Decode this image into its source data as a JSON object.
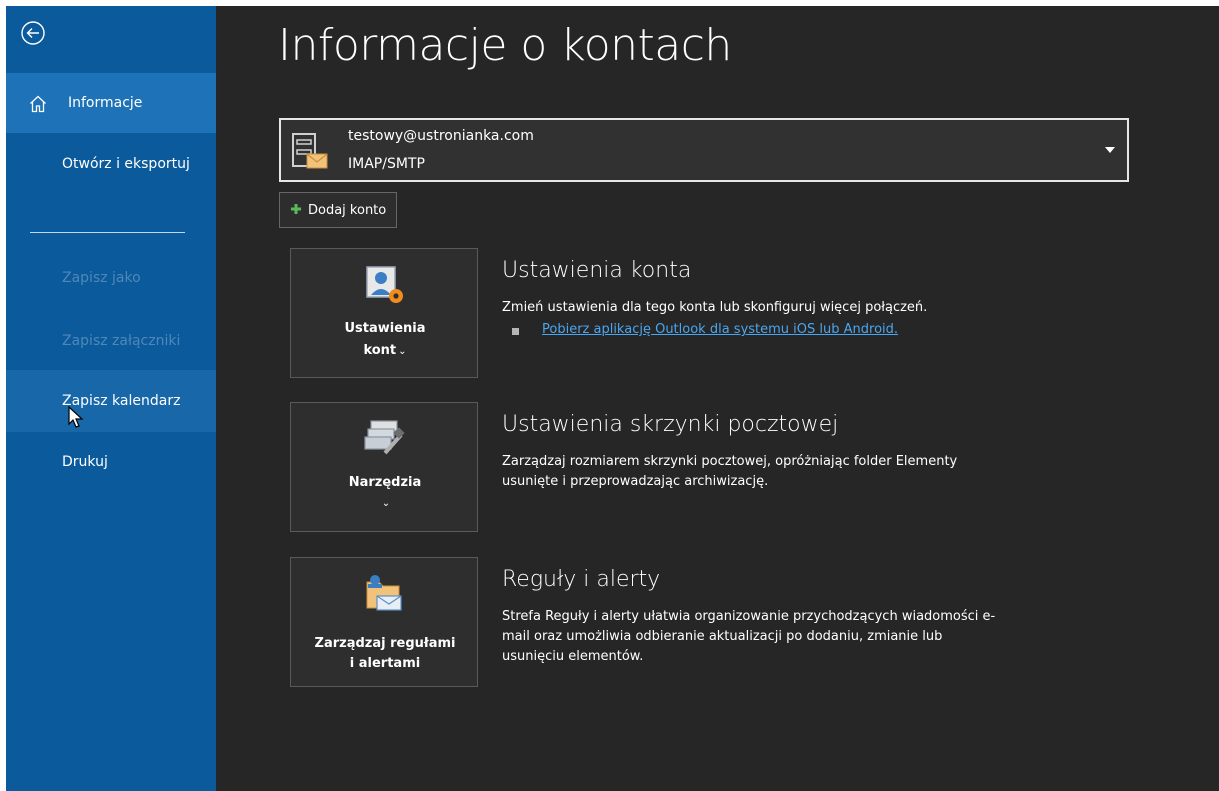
{
  "sidebar": {
    "back_icon": "back-arrow-icon",
    "items": [
      {
        "label": "Informacje",
        "icon": "home-icon",
        "state": "selected"
      },
      {
        "label": "Otwórz i eksportuj",
        "state": "normal"
      },
      {
        "label": "Zapisz jako",
        "state": "disabled"
      },
      {
        "label": "Zapisz załączniki",
        "state": "disabled"
      },
      {
        "label": "Zapisz kalendarz",
        "state": "hover"
      },
      {
        "label": "Drukuj",
        "state": "normal"
      }
    ]
  },
  "page": {
    "title": "Informacje o kontach"
  },
  "account": {
    "email": "testowy@ustronianka.com",
    "type": "IMAP/SMTP",
    "icon": "account-mailbox-icon"
  },
  "add_account": {
    "label": "Dodaj konto",
    "icon": "plus-icon"
  },
  "sections": {
    "account_settings": {
      "tile_label_line1": "Ustawienia",
      "tile_label_line2": "kont",
      "icon": "account-settings-icon",
      "title": "Ustawienia konta",
      "description": "Zmień ustawienia dla tego konta lub skonfiguruj więcej połączeń.",
      "link": "Pobierz aplikację Outlook dla systemu iOS lub Android."
    },
    "mailbox_settings": {
      "tile_label": "Narzędzia",
      "icon": "tools-icon",
      "title": "Ustawienia skrzynki pocztowej",
      "description_line1": "Zarządzaj rozmiarem skrzynki pocztowej, opróżniając folder Elementy",
      "description_line2": "usunięte i przeprowadzając archiwizację."
    },
    "rules_alerts": {
      "tile_label_line1": "Zarządzaj regułami",
      "tile_label_line2": "i alertami",
      "icon": "rules-alerts-icon",
      "title": "Reguły i alerty",
      "description_line1": "Strefa Reguły i alerty ułatwia organizowanie przychodzących wiadomości e-",
      "description_line2": "mail oraz umożliwia odbieranie aktualizacji po dodaniu, zmianie lub",
      "description_line3": "usunięciu elementów."
    }
  },
  "colors": {
    "sidebar": "#0b5a9c",
    "sidebar_selected": "#1e73b8",
    "background": "#262626",
    "link": "#4aa6f0"
  }
}
